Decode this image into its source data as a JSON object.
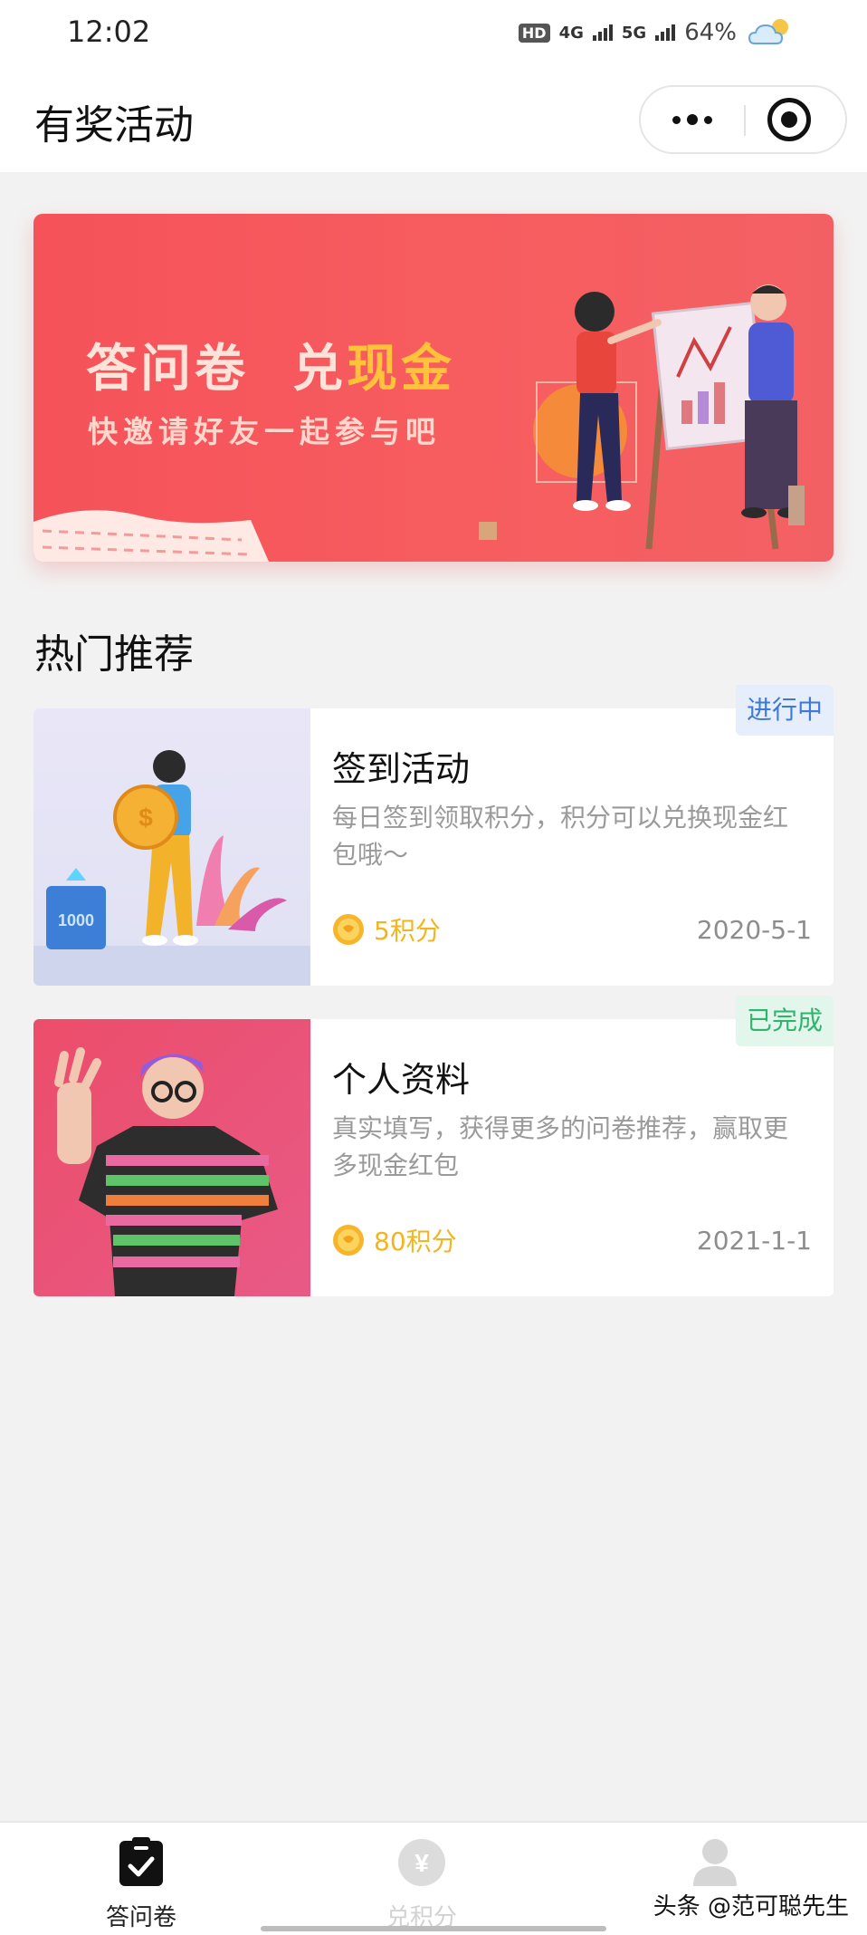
{
  "status_bar": {
    "time": "12:02",
    "hd_label": "HD",
    "net_4g": "4G",
    "net_5g": "5G",
    "battery": "64%",
    "icons": [
      "signal-bars-icon",
      "weather-cloud-icon"
    ]
  },
  "nav": {
    "title": "有奖活动",
    "more_icon": "more-dots-icon",
    "close_icon": "target-close-icon"
  },
  "banner": {
    "title_part1": "答问卷",
    "title_part2": "兑",
    "title_highlight": "现金",
    "subtitle": "快邀请好友一起参与吧"
  },
  "section": {
    "title": "热门推荐"
  },
  "cards": [
    {
      "badge": "进行中",
      "title": "签到活动",
      "desc": "每日签到领取积分，积分可以兑换现金红包哦～",
      "points": "5积分",
      "date": "2020-5-1",
      "thumb_badge_text": "1000"
    },
    {
      "badge": "已完成",
      "title": "个人资料",
      "desc": "真实填写，获得更多的问卷推荐，赢取更多现金红包",
      "points": "80积分",
      "date": "2021-1-1"
    }
  ],
  "tabs": [
    {
      "label": "答问卷",
      "icon": "clipboard-check-icon",
      "active": true
    },
    {
      "label": "兑积分",
      "icon": "yen-coin-icon",
      "active": false
    },
    {
      "label": "",
      "icon": "user-profile-icon",
      "active": false
    }
  ],
  "watermark": "头条 @范可聪先生",
  "colors": {
    "banner_red": "#f5525a",
    "banner_gold": "#ffc23a",
    "badge_ongoing": "#3d79d6",
    "badge_done": "#2fb46e",
    "points_gold": "#f2b51d"
  }
}
